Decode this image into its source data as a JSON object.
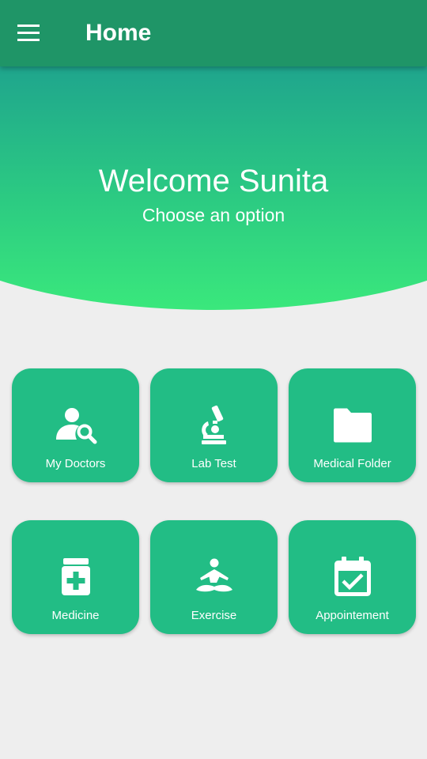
{
  "app_bar": {
    "title": "Home",
    "menu_icon": "hamburger-menu-icon"
  },
  "hero": {
    "welcome": "Welcome Sunita",
    "subtitle": "Choose an option"
  },
  "tiles": [
    {
      "label": "My Doctors",
      "icon": "doctor-search-icon"
    },
    {
      "label": "Lab Test",
      "icon": "microscope-icon"
    },
    {
      "label": "Medical Folder",
      "icon": "folder-icon"
    },
    {
      "label": "Medicine",
      "icon": "medicine-bottle-icon"
    },
    {
      "label": "Exercise",
      "icon": "meditation-icon"
    },
    {
      "label": "Appointement",
      "icon": "calendar-check-icon"
    }
  ],
  "colors": {
    "app_bar": "#1f9567",
    "tile": "#22bd85",
    "hero_top": "#1fa58d",
    "hero_bottom": "#3ae87c",
    "background": "#eeeeee"
  }
}
